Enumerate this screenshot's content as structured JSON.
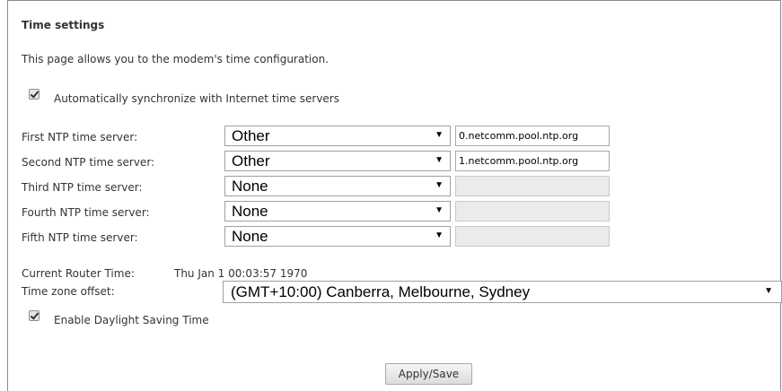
{
  "page": {
    "title": "Time settings",
    "description": "This page allows you to the modem's time configuration."
  },
  "auto_sync": {
    "checked": true,
    "label": "Automatically synchronize with Internet time servers"
  },
  "ntp_servers": [
    {
      "label": "First NTP time server:",
      "selected": "Other",
      "value": "0.netcomm.pool.ntp.org",
      "enabled": true
    },
    {
      "label": "Second NTP time server:",
      "selected": "Other",
      "value": "1.netcomm.pool.ntp.org",
      "enabled": true
    },
    {
      "label": "Third NTP time server:",
      "selected": "None",
      "value": "",
      "enabled": false
    },
    {
      "label": "Fourth NTP time server:",
      "selected": "None",
      "value": "",
      "enabled": false
    },
    {
      "label": "Fifth NTP time server:",
      "selected": "None",
      "value": "",
      "enabled": false
    }
  ],
  "router_time": {
    "label": "Current Router Time:",
    "value": "Thu Jan 1 00:03:57 1970"
  },
  "timezone": {
    "label": "Time zone offset:",
    "selected": "(GMT+10:00) Canberra, Melbourne, Sydney"
  },
  "dst": {
    "checked": true,
    "label": "Enable Daylight Saving Time"
  },
  "actions": {
    "apply_label": "Apply/Save"
  },
  "icons": {
    "dropdown": "dropdown-arrow-icon",
    "arrow_glyph": "▼"
  }
}
